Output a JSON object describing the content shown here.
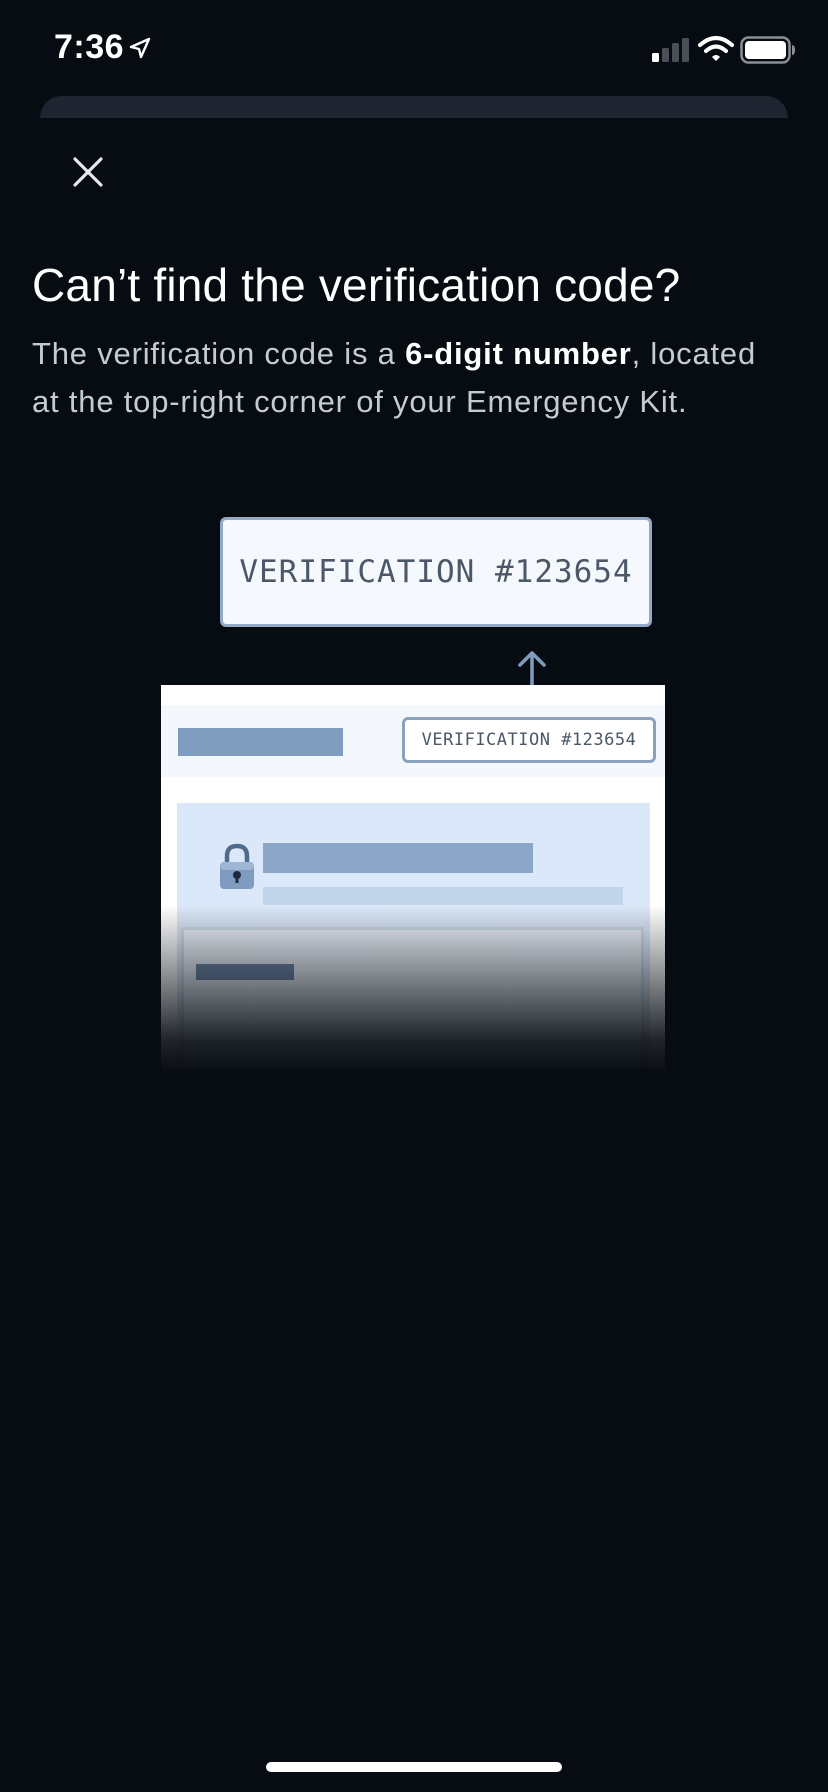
{
  "status_bar": {
    "time": "7:36"
  },
  "sheet": {
    "title": "Can’t find the verification code?",
    "description": {
      "before": "The verification code is a ",
      "bold": "6-digit number",
      "after": ", located at the top-right corner of your Emergency Kit."
    }
  },
  "illustration": {
    "callout_label": "VERIFICATION #123654",
    "badge_label": "VERIFICATION #123654"
  },
  "icons": {
    "close": "close-icon",
    "arrow": "arrow-up-icon",
    "lock": "lock-icon",
    "location": "location-arrow-icon",
    "signal": "cellular-signal-icon",
    "wifi": "wifi-icon",
    "battery": "battery-icon"
  },
  "colors": {
    "background": "#070b12",
    "sheet_handle": "#1f2530",
    "accent_blue": "#8ba6c6",
    "text_secondary": "#c6cbd3"
  }
}
